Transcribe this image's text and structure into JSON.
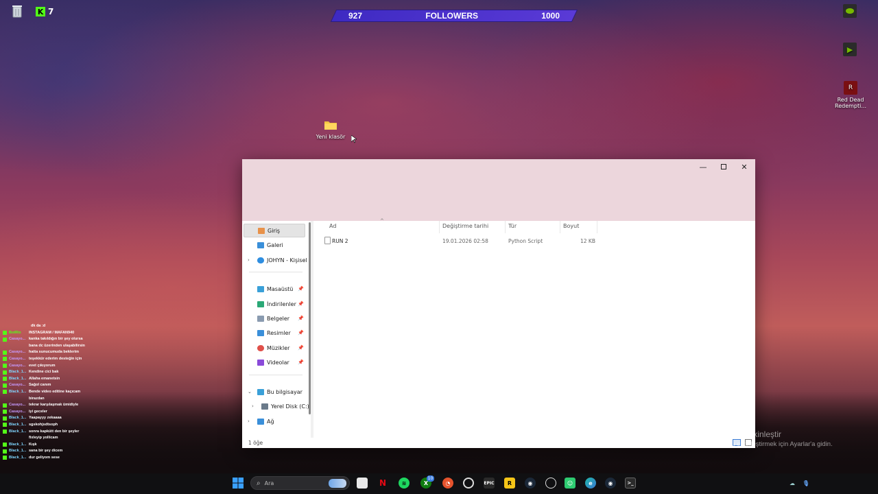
{
  "desktop": {
    "kick_count": "7",
    "followers": {
      "current": "927",
      "label": "FOLLOWERS",
      "goal": "1000"
    },
    "icons": [
      {
        "label": "Yeni klasör"
      },
      {
        "label": "Red Dead Redempti..."
      }
    ],
    "watermark": {
      "line1": "Windows'u Etkinleştir",
      "line2": "Windows'u etkinleştirmek için Ayarlar'a gidin."
    }
  },
  "chat": [
    {
      "user": "",
      "msg": "dk da :d"
    },
    {
      "user": "BotRix",
      "msg": "INSTAGRAM / MAFAN940",
      "color": "#53fc18"
    },
    {
      "user": "Casayo...",
      "msg": "kanka takıldığın bir şey olursa bana dc üzerinden ulaşabilirsin",
      "color": "#c79bff"
    },
    {
      "user": "Casayo...",
      "msg": "hatta sunucumuda beklerim",
      "color": "#c79bff"
    },
    {
      "user": "Casayo...",
      "msg": "teşekkür ederim desteğin için",
      "color": "#c79bff"
    },
    {
      "user": "Casayo...",
      "msg": "evet çıkıyorum",
      "color": "#c79bff"
    },
    {
      "user": "Black_1...",
      "msg": "Kendine cici bak",
      "color": "#7fd6ff"
    },
    {
      "user": "Black_1...",
      "msg": "Allaha emanetsin",
      "color": "#7fd6ff"
    },
    {
      "user": "Casayo...",
      "msg": "Sağol canım",
      "color": "#c79bff"
    },
    {
      "user": "Black_1...",
      "msg": "Bende video editine kaçıcam birazdan",
      "color": "#7fd6ff"
    },
    {
      "user": "Casayo...",
      "msg": "tekrar karşılaşmak ümidiyle",
      "color": "#c79bff"
    },
    {
      "user": "Casayo...",
      "msg": "iyi geceler",
      "color": "#c79bff"
    },
    {
      "user": "Black_1...",
      "msg": "Yaapayyy zekaaaa",
      "color": "#7fd6ff"
    },
    {
      "user": "Black_1...",
      "msg": "sgskohjsdtsoph",
      "color": "#7fd6ff"
    },
    {
      "user": "Black_1...",
      "msg": "sonra kapkütt den bir şeyler fixleyip yollicam",
      "color": "#7fd6ff"
    },
    {
      "user": "Black_1...",
      "msg": "Kışk",
      "color": "#7fd6ff"
    },
    {
      "user": "Black_1...",
      "msg": "sana bir şey dicem",
      "color": "#7fd6ff"
    },
    {
      "user": "Black_1...",
      "msg": "dur geliyom sese",
      "color": "#7fd6ff"
    }
  ],
  "explorer": {
    "nav": {
      "home": "Giriş",
      "gallery": "Galeri",
      "onedrive": "JOHYN - Kişisel",
      "desktop": "Masaüstü",
      "downloads": "İndirilenler",
      "documents": "Belgeler",
      "pictures": "Resimler",
      "music": "Müzikler",
      "videos": "Videolar",
      "this_pc": "Bu bilgisayar",
      "local_disk": "Yerel Disk (C:)",
      "network": "Ağ"
    },
    "columns": {
      "name": "Ad",
      "modified": "Değiştirme tarihi",
      "type": "Tür",
      "size": "Boyut"
    },
    "files": [
      {
        "name": "RUN 2",
        "modified": "19.01.2026 02:58",
        "type": "Python Script",
        "size": "12 KB"
      }
    ],
    "status": "1 öğe"
  },
  "taskbar": {
    "search_placeholder": "Ara",
    "badge": "10"
  }
}
